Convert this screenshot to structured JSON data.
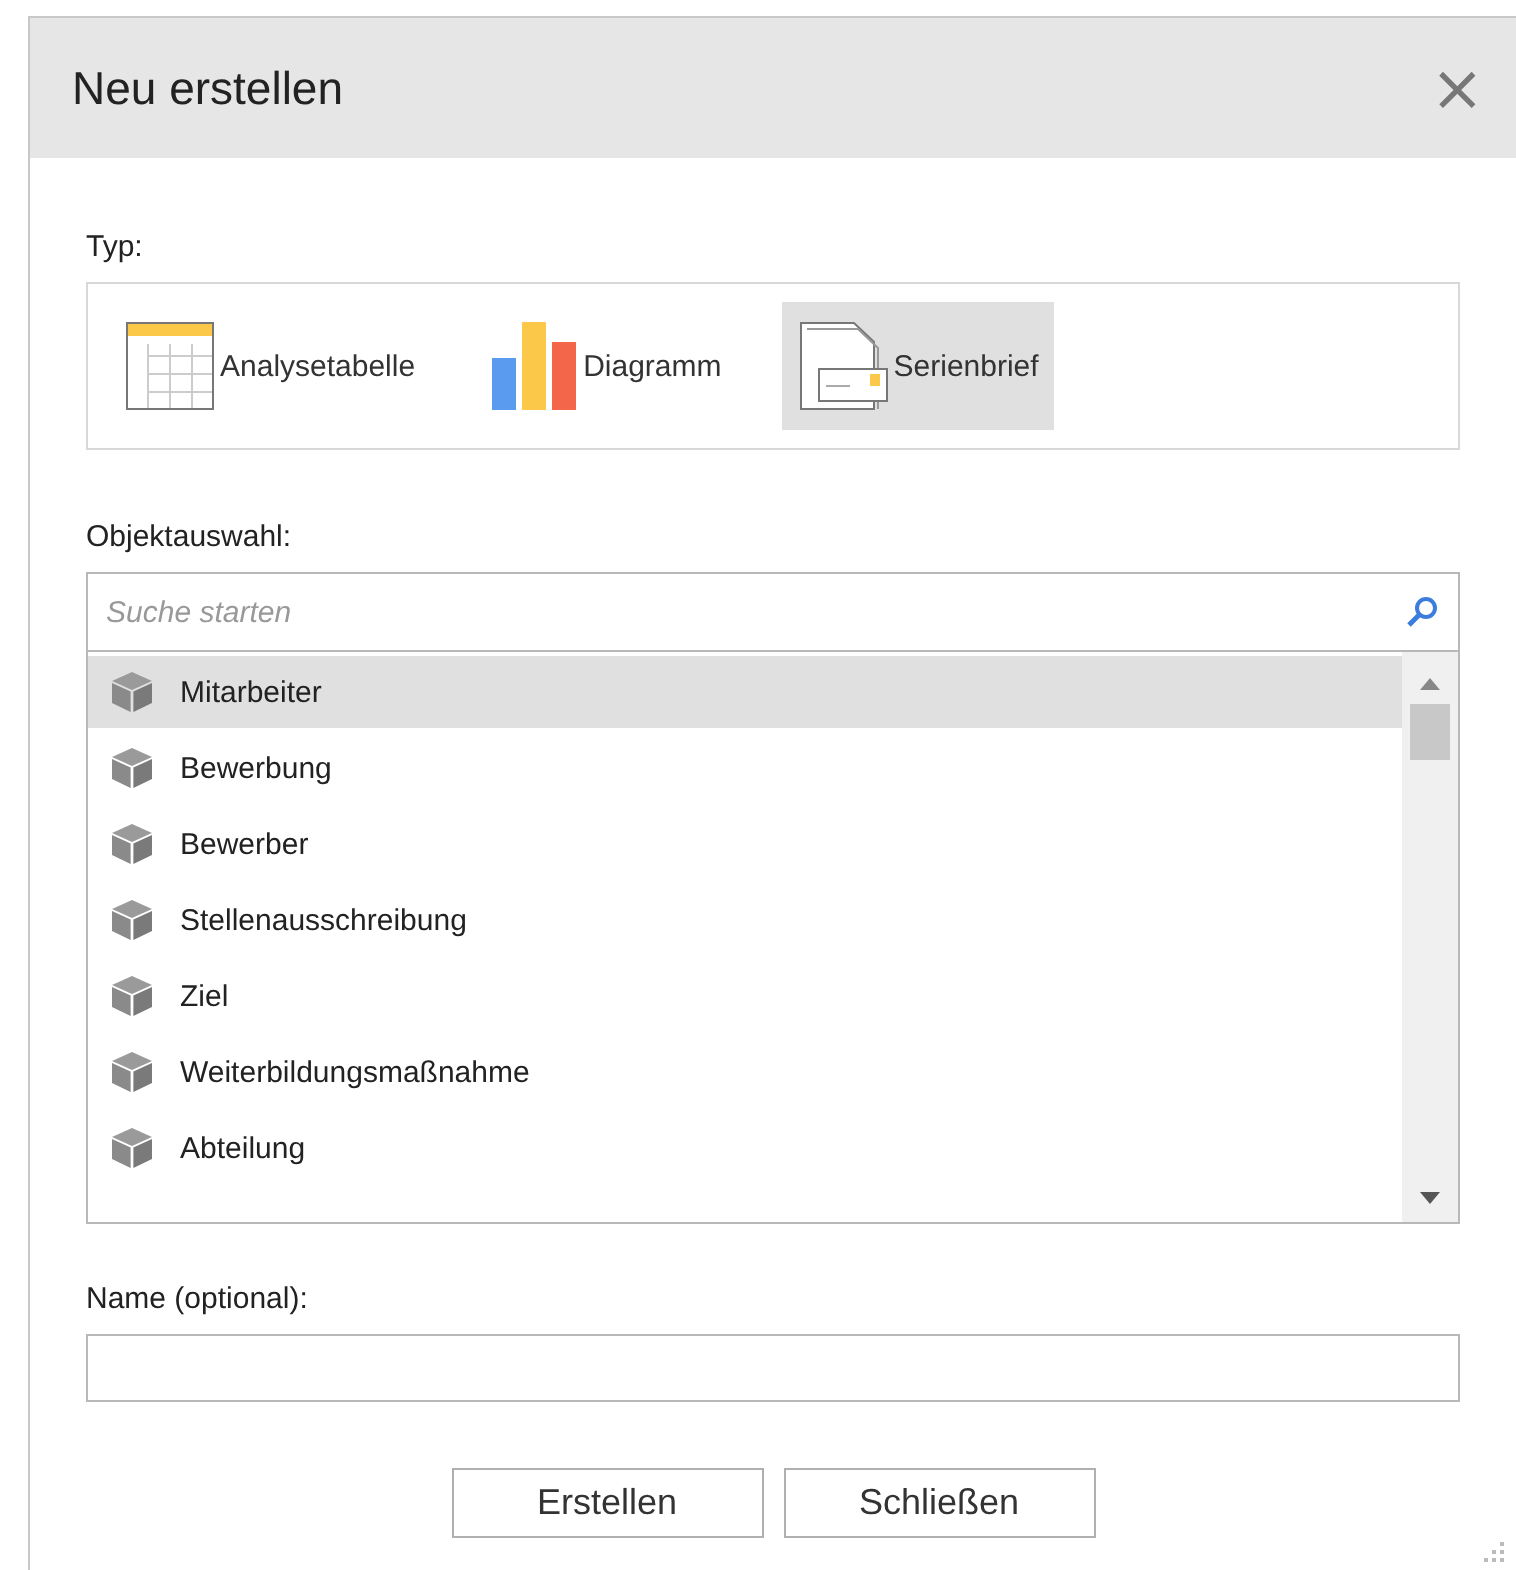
{
  "dialog": {
    "title": "Neu erstellen",
    "close": "×"
  },
  "type_section": {
    "label": "Typ:",
    "options": [
      {
        "kind": "table",
        "label": "Analysetabelle",
        "selected": false
      },
      {
        "kind": "chart",
        "label": "Diagramm",
        "selected": false
      },
      {
        "kind": "letter",
        "label": "Serienbrief",
        "selected": true
      }
    ]
  },
  "object_section": {
    "label": "Objektauswahl:",
    "search": {
      "placeholder": "Suche starten"
    },
    "items": [
      {
        "label": "Mitarbeiter",
        "selected": true
      },
      {
        "label": "Bewerbung",
        "selected": false
      },
      {
        "label": "Bewerber",
        "selected": false
      },
      {
        "label": "Stellenausschreibung",
        "selected": false
      },
      {
        "label": "Ziel",
        "selected": false
      },
      {
        "label": "Weiterbildungsmaßnahme",
        "selected": false
      },
      {
        "label": "Abteilung",
        "selected": false
      }
    ]
  },
  "name_section": {
    "label": "Name (optional):"
  },
  "buttons": [
    "Erstellen",
    "Schließen"
  ]
}
